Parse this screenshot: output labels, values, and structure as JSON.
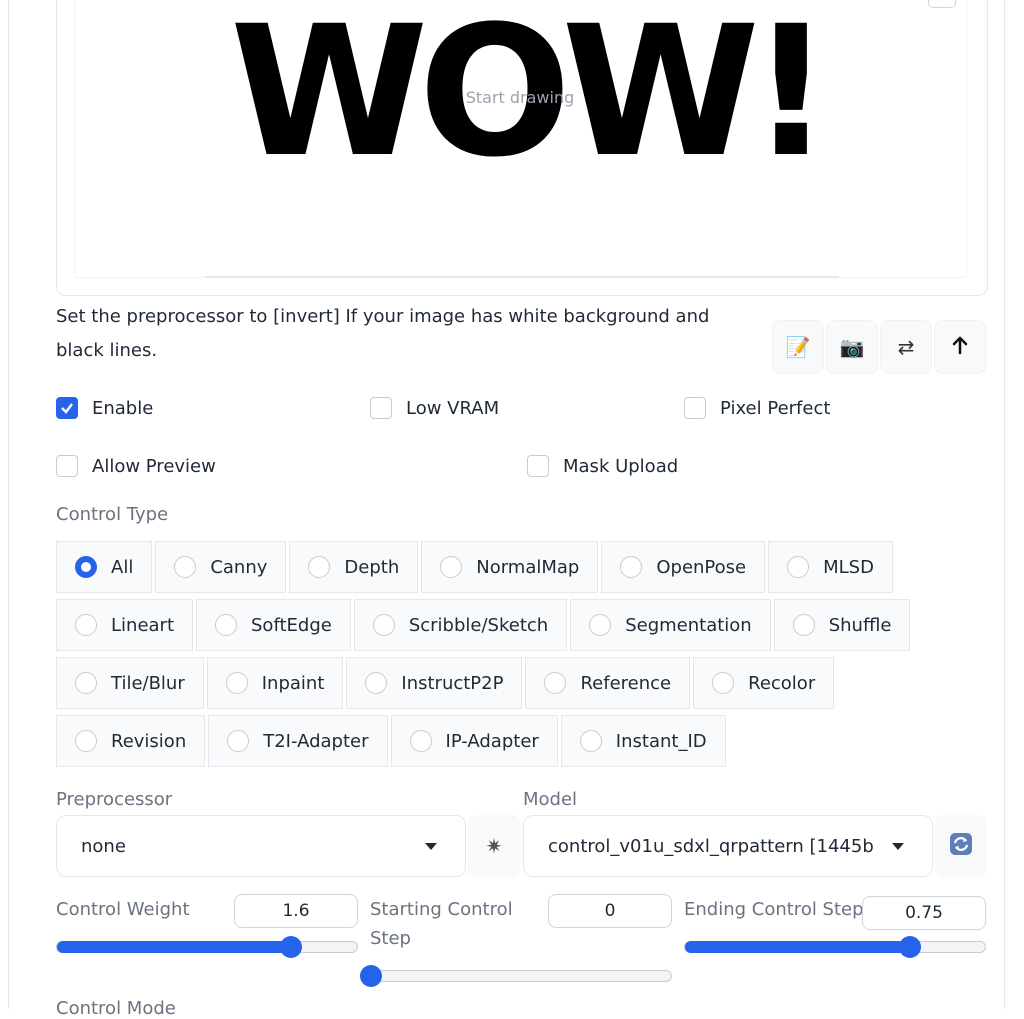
{
  "canvas": {
    "big_text": "WOW!",
    "placeholder": "Start drawing"
  },
  "hint": "Set the preprocessor to [invert] If your image has white background and black lines.",
  "tools": [
    {
      "icon": "edit-icon",
      "glyph": "📝"
    },
    {
      "icon": "camera-icon",
      "glyph": "📷"
    },
    {
      "icon": "swap-icon",
      "glyph": "⇄"
    },
    {
      "icon": "send-up-icon",
      "glyph": "↰"
    }
  ],
  "checkboxes": {
    "enable": {
      "label": "Enable",
      "checked": true
    },
    "low_vram": {
      "label": "Low VRAM",
      "checked": false
    },
    "pixel_perfect": {
      "label": "Pixel Perfect",
      "checked": false
    },
    "allow_preview": {
      "label": "Allow Preview",
      "checked": false
    },
    "mask_upload": {
      "label": "Mask Upload",
      "checked": false
    }
  },
  "control_type": {
    "label": "Control Type",
    "selected": "All",
    "rows": [
      [
        "All",
        "Canny",
        "Depth",
        "NormalMap",
        "OpenPose",
        "MLSD"
      ],
      [
        "Lineart",
        "SoftEdge",
        "Scribble/Sketch",
        "Segmentation",
        "Shuffle"
      ],
      [
        "Tile/Blur",
        "Inpaint",
        "InstructP2P",
        "Reference",
        "Recolor"
      ],
      [
        "Revision",
        "T2I-Adapter",
        "IP-Adapter",
        "Instant_ID"
      ]
    ]
  },
  "preprocessor": {
    "label": "Preprocessor",
    "value": "none",
    "run_icon": "explosion-icon"
  },
  "model": {
    "label": "Model",
    "value": "control_v01u_sdxl_qrpattern [1445b",
    "refresh_icon": "refresh-icon"
  },
  "sliders": {
    "control_weight": {
      "label": "Control Weight",
      "value": "1.6",
      "fraction": 0.78
    },
    "starting_control_step": {
      "label": "Starting Control Step",
      "value": "0",
      "fraction": 0.0
    },
    "ending_control_step": {
      "label": "Ending Control Step",
      "value": "0.75",
      "fraction": 0.75
    }
  },
  "control_mode": {
    "label": "Control Mode"
  },
  "colors": {
    "accent": "#2563eb"
  }
}
